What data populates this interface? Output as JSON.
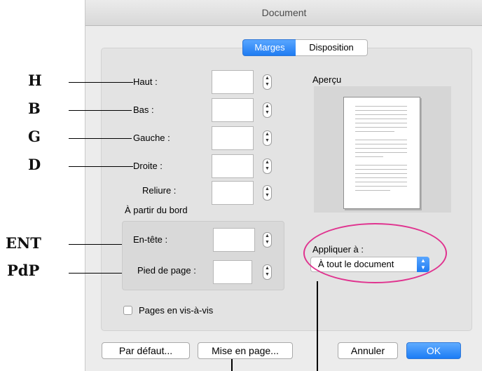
{
  "window": {
    "title": "Document"
  },
  "tabs": [
    {
      "label": "Marges",
      "selected": true
    },
    {
      "label": "Disposition",
      "selected": false
    }
  ],
  "annotations": {
    "haut": "H",
    "bas": "B",
    "gauche": "G",
    "droite": "D",
    "entete": "ENT",
    "pied": "PdP"
  },
  "margins": {
    "haut": {
      "label": "Haut :",
      "value": ""
    },
    "bas": {
      "label": "Bas :",
      "value": ""
    },
    "gauche": {
      "label": "Gauche :",
      "value": ""
    },
    "droite": {
      "label": "Droite :",
      "value": ""
    },
    "reliure": {
      "label": "Reliure :",
      "value": ""
    }
  },
  "from_edge": {
    "title": "À partir du bord",
    "entete": {
      "label": "En-tête :",
      "value": ""
    },
    "pied": {
      "label": "Pied de page :",
      "value": ""
    }
  },
  "preview": {
    "label": "Aperçu"
  },
  "apply": {
    "label": "Appliquer à :",
    "selected": "À tout le document"
  },
  "mirror_pages": {
    "label": "Pages en vis-à-vis",
    "checked": false
  },
  "buttons": {
    "default": "Par défaut...",
    "page_setup": "Mise en page...",
    "cancel": "Annuler",
    "ok": "OK"
  },
  "colors": {
    "accent": "#1f7cf2",
    "highlight_ellipse": "#e0338f"
  }
}
